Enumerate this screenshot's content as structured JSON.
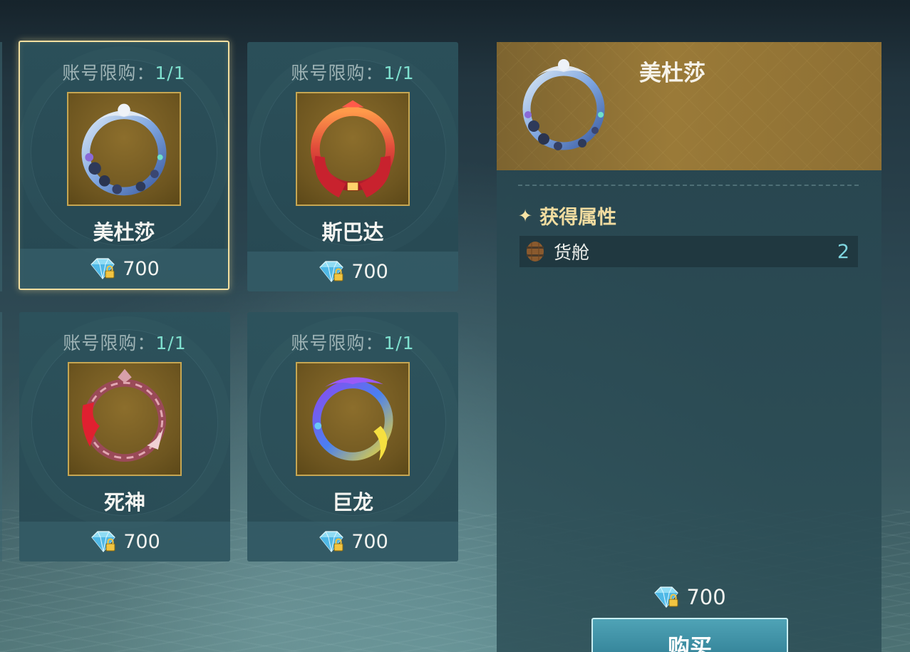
{
  "shop": {
    "items": [
      {
        "limit_label": "账号限购：",
        "limit_count": "1/1",
        "name": "美杜莎",
        "price": "700",
        "selected": true,
        "frame": "medusa"
      },
      {
        "limit_label": "账号限购：",
        "limit_count": "1/1",
        "name": "斯巴达",
        "price": "700",
        "selected": false,
        "frame": "sparta"
      },
      {
        "limit_label": "账号限购：",
        "limit_count": "1/1",
        "name": "死神",
        "price": "700",
        "selected": false,
        "frame": "reaper"
      },
      {
        "limit_label": "账号限购：",
        "limit_count": "1/1",
        "name": "巨龙",
        "price": "700",
        "selected": false,
        "frame": "dragon"
      }
    ]
  },
  "detail": {
    "title": "美杜莎",
    "attributes_heading": "获得属性",
    "attributes": [
      {
        "icon": "barrel-icon",
        "name": "货舱",
        "value": "2"
      }
    ],
    "price": "700",
    "buy_label": "购买"
  },
  "icons": {
    "currency": "diamond-lock-icon",
    "heading_marker": "sparkle-icon"
  },
  "colors": {
    "limit_count": "#7fe0cf",
    "selected_border": "#f2dfa0",
    "attribute_value": "#7fd6e0",
    "heading": "#f1dca0",
    "buy_button": "#3f93a8"
  }
}
